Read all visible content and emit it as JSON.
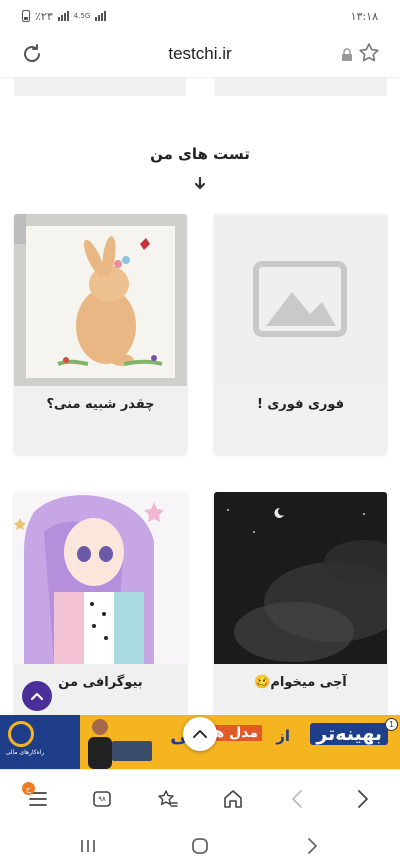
{
  "status_bar": {
    "battery": "٪۲۳",
    "network": "4.5G",
    "time": "۱۳:۱۸"
  },
  "browser": {
    "url": "testchi.ir",
    "toolbar": {
      "menu_badge": "ح",
      "tabs_count": "۹۸"
    }
  },
  "section": {
    "title": "تست های من"
  },
  "cards": [
    {
      "label": "فوری فوری !",
      "image": "placeholder-image-icon"
    },
    {
      "label": "چقدر شبیه منی؟",
      "image": "bunny-painting"
    },
    {
      "label": "آجی میخوام🥴",
      "image": "night-sky-photo"
    },
    {
      "label": "بیوگرافی من",
      "image": "anime-girl-drawing"
    }
  ],
  "ad": {
    "headline": "بهینه‌تر",
    "from": "از",
    "models": "مدل های",
    "rest": "رجی",
    "close": "1",
    "brand_line": "راه‌کارهای مالی"
  },
  "colors": {
    "accent_purple": "#4a2f9a",
    "ad_yellow": "#f5b521",
    "ad_blue": "#1f3e8a",
    "badge_orange": "#f07b22"
  }
}
